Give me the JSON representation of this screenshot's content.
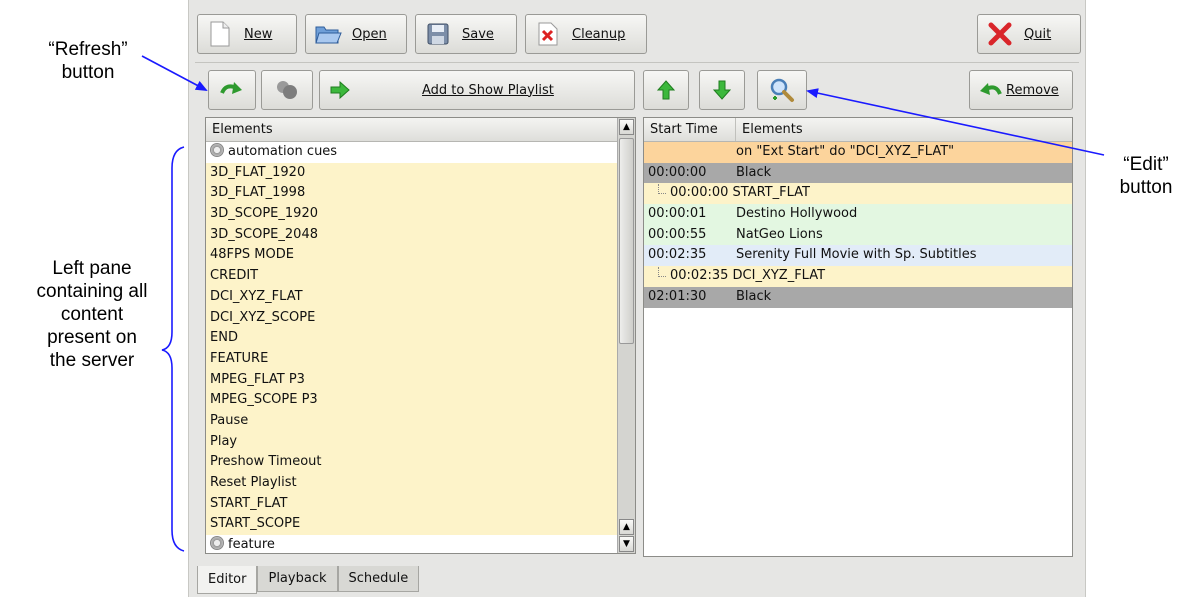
{
  "annotations": {
    "refresh_line1": "“Refresh”",
    "refresh_line2": "button",
    "edit_line1": "“Edit”",
    "edit_line2": "button",
    "left_line1": "Left pane",
    "left_line2": "containing all",
    "left_line3": "content",
    "left_line4": "present on",
    "left_line5": "the server"
  },
  "toolbar": {
    "new_label": "New",
    "open_label": "Open",
    "save_label": "Save",
    "cleanup_label": "Cleanup",
    "quit_label": "Quit"
  },
  "actions": {
    "add_label": "Add to Show Playlist",
    "remove_label": "Remove"
  },
  "left_pane": {
    "header": "Elements",
    "items": [
      {
        "label": "automation cues",
        "kind": "group"
      },
      {
        "label": "3D_FLAT_1920",
        "kind": "item"
      },
      {
        "label": "3D_FLAT_1998",
        "kind": "item"
      },
      {
        "label": "3D_SCOPE_1920",
        "kind": "item"
      },
      {
        "label": "3D_SCOPE_2048",
        "kind": "item"
      },
      {
        "label": "48FPS MODE",
        "kind": "item"
      },
      {
        "label": "CREDIT",
        "kind": "item"
      },
      {
        "label": "DCI_XYZ_FLAT",
        "kind": "item"
      },
      {
        "label": "DCI_XYZ_SCOPE",
        "kind": "item"
      },
      {
        "label": "END",
        "kind": "item"
      },
      {
        "label": "FEATURE",
        "kind": "item"
      },
      {
        "label": "MPEG_FLAT P3",
        "kind": "item"
      },
      {
        "label": "MPEG_SCOPE P3",
        "kind": "item"
      },
      {
        "label": "Pause",
        "kind": "item"
      },
      {
        "label": "Play",
        "kind": "item"
      },
      {
        "label": "Preshow Timeout",
        "kind": "item"
      },
      {
        "label": "Reset Playlist",
        "kind": "item"
      },
      {
        "label": "START_FLAT",
        "kind": "item"
      },
      {
        "label": "START_SCOPE",
        "kind": "item"
      },
      {
        "label": "feature",
        "kind": "group"
      }
    ]
  },
  "right_pane": {
    "col_time": "Start Time",
    "col_elements": "Elements",
    "rows": [
      {
        "time": "",
        "element": "on \"Ext Start\" do \"DCI_XYZ_FLAT\"",
        "color": "#fcd49c",
        "indent": false
      },
      {
        "time": "00:00:00",
        "element": "Black",
        "color": "#a8a8a8",
        "indent": false
      },
      {
        "time": "",
        "element": "00:00:00 START_FLAT",
        "color": "#fdf3c9",
        "indent": true
      },
      {
        "time": "00:00:01",
        "element": "Destino Hollywood",
        "color": "#e3f7e1",
        "indent": false
      },
      {
        "time": "00:00:55",
        "element": "NatGeo Lions",
        "color": "#e3f7e1",
        "indent": false
      },
      {
        "time": "00:02:35",
        "element": "Serenity Full Movie with Sp. Subtitles",
        "color": "#e2ecf8",
        "indent": false
      },
      {
        "time": "",
        "element": "00:02:35 DCI_XYZ_FLAT",
        "color": "#fdf3c9",
        "indent": true
      },
      {
        "time": "02:01:30",
        "element": "Black",
        "color": "#a8a8a8",
        "indent": false
      }
    ]
  },
  "tabs": [
    "Editor",
    "Playback",
    "Schedule"
  ],
  "colors": {
    "item_bg": "#fdf3c9",
    "cue_bg": "#fcd49c",
    "black_bg": "#a8a8a8",
    "content_bg": "#e3f7e1",
    "feature_bg": "#e2ecf8",
    "annotation_line": "#1a1aff"
  }
}
